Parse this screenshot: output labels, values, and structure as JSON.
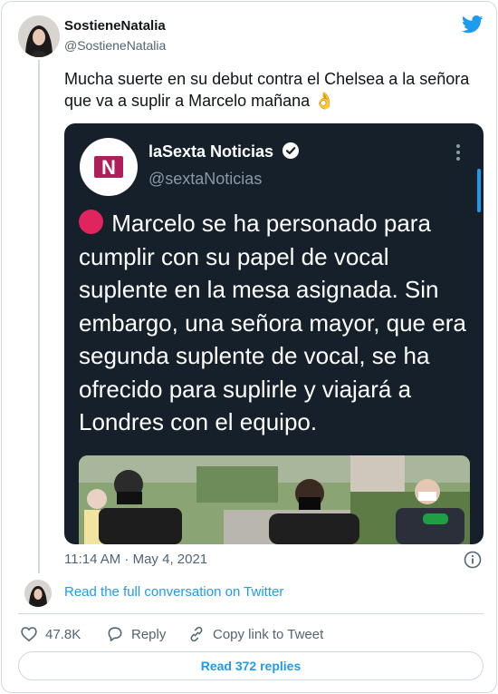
{
  "author": {
    "name": "SostieneNatalia",
    "handle": "@SostieneNatalia"
  },
  "tweet": {
    "text": "Mucha suerte en su debut contra el Chelsea a la señora que va a suplir a Marcelo mañana",
    "emoji": "👌",
    "timestamp": "11:14 AM · May 4, 2021"
  },
  "quoted": {
    "name": "laSexta Noticias",
    "handle": "@sextaNoticias",
    "text": "Marcelo se ha personado para cumplir con su papel de vocal suplente en la mesa asignada. Sin embargo, una señora mayor, que era segunda suplente de vocal, se ha ofrecido para suplirle y viajará a Londres con el equipo.",
    "logo_letter": "N",
    "colors": {
      "background": "#15202b",
      "logo_bg": "#ad1e5a",
      "dot": "#e0245e"
    }
  },
  "footer": {
    "read_conversation": "Read the full conversation on Twitter",
    "likes": "47.8K",
    "reply_label": "Reply",
    "copy_label": "Copy link to Tweet",
    "read_replies": "Read 372 replies"
  },
  "icons": [
    "twitter-bird-icon",
    "verified-badge-icon",
    "more-icon",
    "info-icon",
    "heart-icon",
    "reply-bubble-icon",
    "link-icon"
  ],
  "accent": "#1d9bf0"
}
